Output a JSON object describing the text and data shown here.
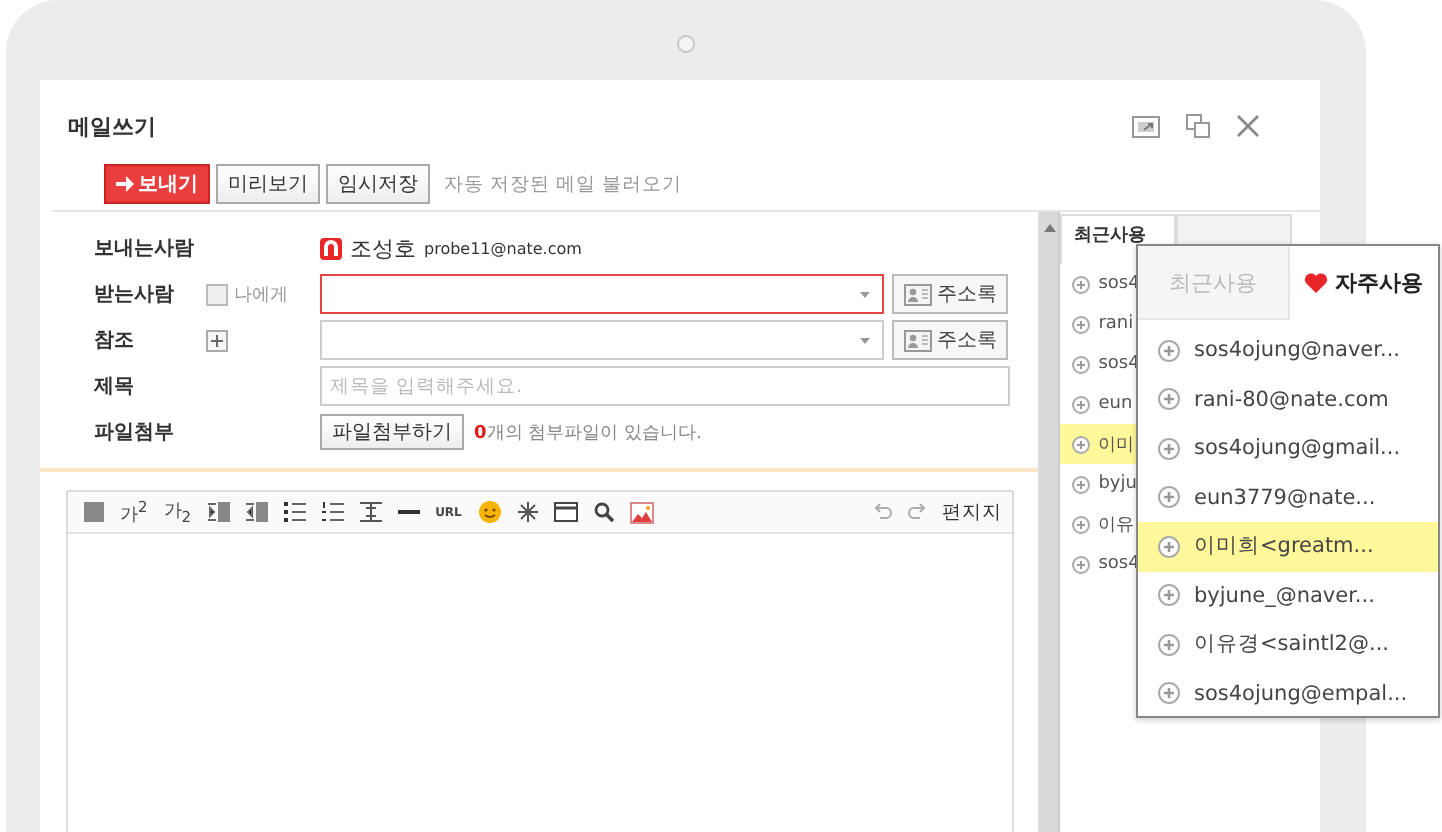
{
  "window": {
    "title": "메일쓰기"
  },
  "actions": {
    "send": "보내기",
    "preview": "미리보기",
    "save_draft": "임시저장",
    "load_saved": "자동 저장된 메일 불러오기"
  },
  "form": {
    "sender_label": "보내는사람",
    "sender_name": "조성호",
    "sender_email": "probe11@nate.com",
    "to_label": "받는사람",
    "to_me": {
      "label": "나에게",
      "checked": false
    },
    "to_invalid": true,
    "address_book": "주소록",
    "cc_label": "참조",
    "cc_address_book": "주소록",
    "subject_label": "제목",
    "subject_placeholder": "제목을 입력해주세요.",
    "attach_label": "파일첨부",
    "attach_button": "파일첨부하기",
    "attach_count": "0",
    "attach_note": "개의 첨부파일이 있습니다."
  },
  "editor": {
    "superscript": "가$^{2}$",
    "subscript": "가$_{2}$",
    "url": "URL",
    "stationery": "편지지"
  },
  "side_panel": {
    "tabs": [
      {
        "label": "최근사용",
        "selected": true
      }
    ],
    "items": [
      {
        "label": "sos4",
        "selected": false
      },
      {
        "label": "rani",
        "selected": false
      },
      {
        "label": "sos4",
        "selected": false
      },
      {
        "label": "eun",
        "selected": false
      },
      {
        "label": "이미",
        "selected": true
      },
      {
        "label": "byju",
        "selected": false
      },
      {
        "label": "이유",
        "selected": false
      },
      {
        "label": "sos4",
        "selected": false
      }
    ]
  },
  "popup": {
    "tabs": [
      {
        "label": "최근사용",
        "selected": false
      },
      {
        "label": "자주사용",
        "selected": true
      }
    ],
    "items": [
      {
        "label": "sos4ojung@naver...",
        "selected": false
      },
      {
        "label": "rani-80@nate.com",
        "selected": false
      },
      {
        "label": "sos4ojung@gmail...",
        "selected": false
      },
      {
        "label": "eun3779@nate...",
        "selected": false
      },
      {
        "label": "이미희<greatm...",
        "selected": true
      },
      {
        "label": "byjune_@naver...",
        "selected": false
      },
      {
        "label": "이유경<saintl2@...",
        "selected": false
      },
      {
        "label": "sos4ojung@empal...",
        "selected": false
      }
    ]
  }
}
